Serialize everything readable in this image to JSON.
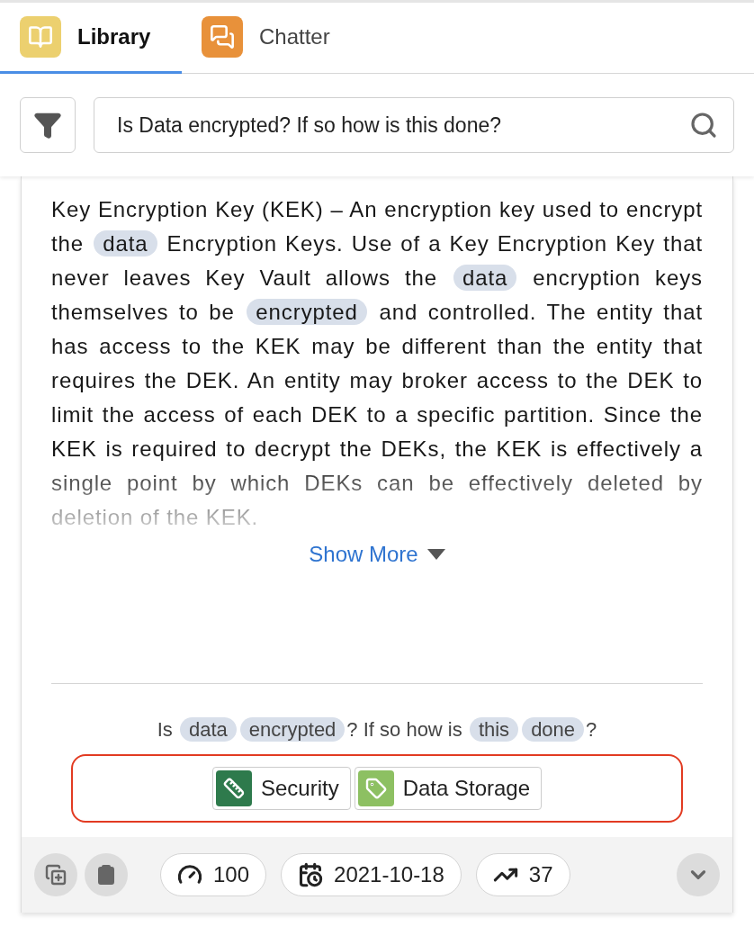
{
  "tabs": [
    {
      "label": "Library",
      "kind": "library",
      "selected": true
    },
    {
      "label": "Chatter",
      "kind": "chatter",
      "selected": false
    }
  ],
  "search": {
    "value": "Is Data encrypted? If so how is this done?"
  },
  "answer": {
    "segments": [
      {
        "text": "Key Encryption Key (KEK) – An encryption key used to encrypt the ",
        "highlight": false
      },
      {
        "text": "data",
        "highlight": true
      },
      {
        "text": " Encryption Keys. Use of a Key Encryption Key that never leaves Key Vault allows the ",
        "highlight": false
      },
      {
        "text": "data",
        "highlight": true
      },
      {
        "text": " encryption keys themselves to be ",
        "highlight": false
      },
      {
        "text": "encrypted",
        "highlight": true
      },
      {
        "text": " and controlled. The entity that has access to the KEK may be different than the entity that requires the DEK. An entity may broker access to the DEK to limit the access of each DEK to a specific partition. Since the KEK is required to decrypt the DEKs, the KEK is effectively a single point by which DEKs can be effectively deleted by deletion of the KEK.",
        "highlight": false
      }
    ],
    "show_more": "Show More"
  },
  "question": {
    "segments": [
      {
        "text": "Is ",
        "highlight": false
      },
      {
        "text": "data",
        "highlight": true
      },
      {
        "text": "encrypted",
        "highlight": true
      },
      {
        "text": "? If so how is ",
        "highlight": false
      },
      {
        "text": "this",
        "highlight": true
      },
      {
        "text": "done",
        "highlight": true
      },
      {
        "text": "?",
        "highlight": false
      }
    ]
  },
  "tags": [
    {
      "label": "Security",
      "kind": "security",
      "color": "#2e7a4c"
    },
    {
      "label": "Data Storage",
      "kind": "storage",
      "color": "#8dc062"
    }
  ],
  "footer": {
    "stats": [
      {
        "kind": "score",
        "value": "100"
      },
      {
        "kind": "date",
        "value": "2021-10-18"
      },
      {
        "kind": "trend",
        "value": "37"
      }
    ]
  }
}
